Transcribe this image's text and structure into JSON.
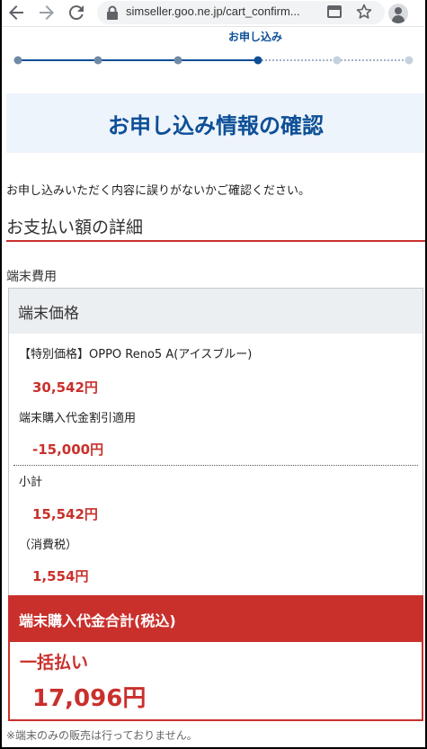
{
  "browser": {
    "url": "simseller.goo.ne.jp/cart_confirm..."
  },
  "stepper": {
    "current_label": "お申し込み",
    "total_steps": 6,
    "current_step": 4
  },
  "page": {
    "title": "お申し込み情報の確認",
    "intro": "お申し込みいただく内容に誤りがないかご確認ください。",
    "section_title": "お支払い額の詳細",
    "subheading": "端末費用"
  },
  "breakdown": {
    "header": "端末価格",
    "rows": [
      {
        "label": "【特別価格】OPPO Reno5 A(アイスブルー)",
        "amount": "30,542円"
      },
      {
        "label": "端末購入代金割引適用",
        "amount": "-15,000円"
      },
      {
        "label": "小計",
        "amount": "15,542円"
      },
      {
        "label": "（消費税）",
        "amount": "1,554円"
      }
    ]
  },
  "total": {
    "header": "端末購入代金合計(税込)",
    "pay_label": "一括払い",
    "amount": "17,096円"
  },
  "footer_note": "※端末のみの販売は行っておりません。",
  "colors": {
    "brand_blue": "#0d4f97",
    "accent_red": "#c9302c",
    "step_done": "#6f8aa6",
    "step_pending": "#c5d1de"
  }
}
